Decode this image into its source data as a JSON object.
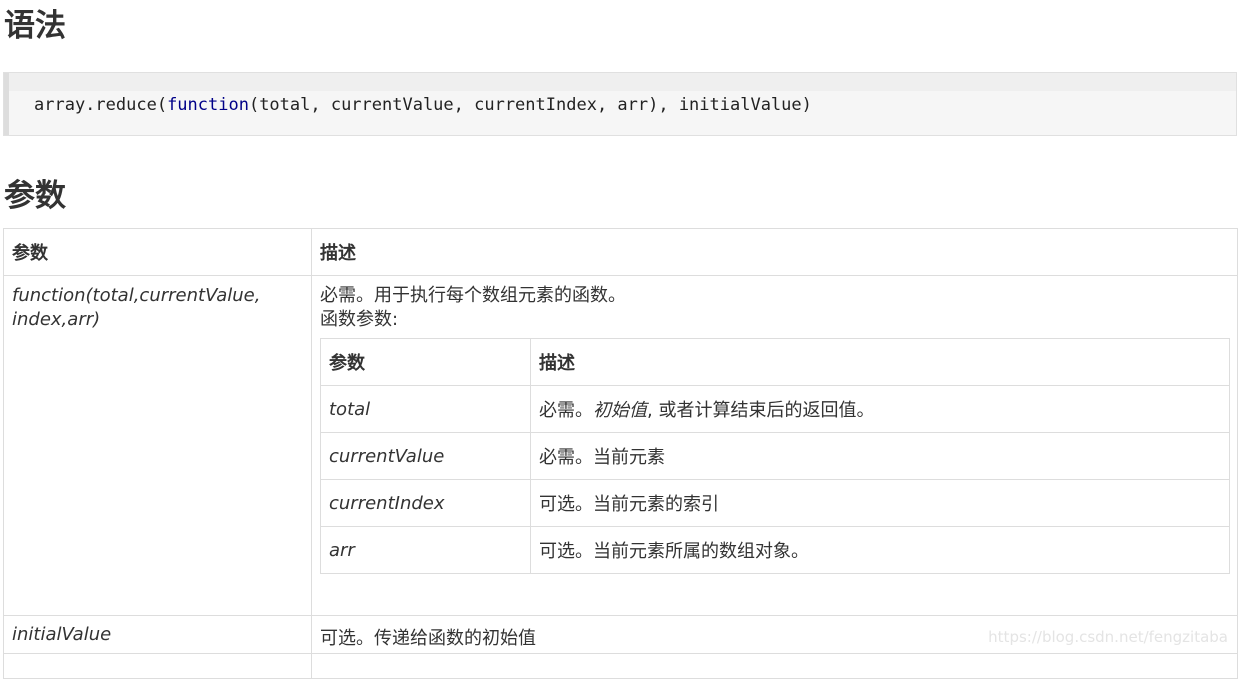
{
  "headings": {
    "syntax": "语法",
    "parameters": "参数"
  },
  "code": {
    "obj": "array.reduce(",
    "keyword": "function",
    "args": "(total, currentValue, currentIndex, arr), initialValue)"
  },
  "table": {
    "headers": {
      "param": "参数",
      "desc": "描述"
    },
    "rows": [
      {
        "param": "function(total,currentValue, index,arr)",
        "desc_line1": "必需。用于执行每个数组元素的函数。",
        "desc_line2": "函数参数:",
        "inner": {
          "headers": {
            "param": "参数",
            "desc": "描述"
          },
          "rows": [
            {
              "param": "total",
              "desc_prefix": "必需。",
              "desc_italic": "初始值",
              "desc_suffix": ", 或者计算结束后的返回值。"
            },
            {
              "param": "currentValue",
              "desc": "必需。当前元素"
            },
            {
              "param": "currentIndex",
              "desc": "可选。当前元素的索引"
            },
            {
              "param": "arr",
              "desc": "可选。当前元素所属的数组对象。"
            }
          ]
        }
      },
      {
        "param": "initialValue",
        "desc": "可选。传递给函数的初始值"
      }
    ]
  },
  "watermark": "https://blog.csdn.net/fengzitaba"
}
